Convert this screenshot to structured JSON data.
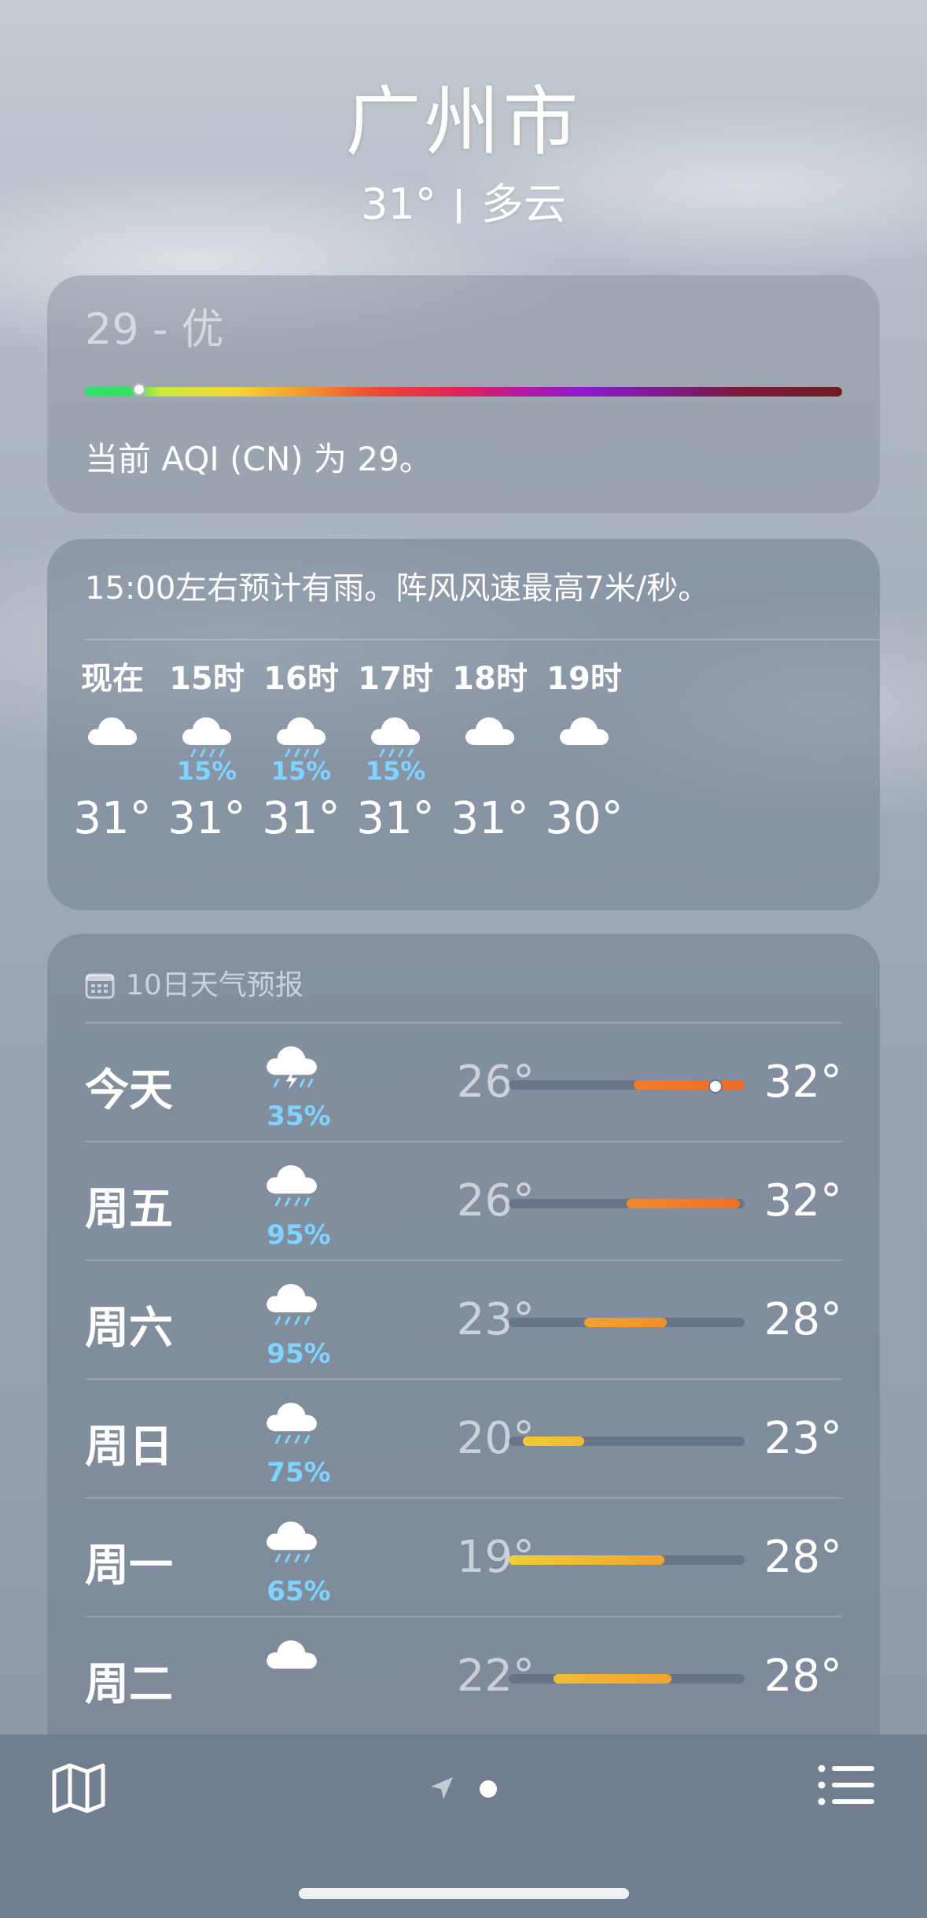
{
  "header": {
    "city": "广州市",
    "temp": "31°",
    "condition": "多云"
  },
  "aqi": {
    "value_label": "29 - 优",
    "description": "当前 AQI (CN) 为 29。",
    "value": 29
  },
  "hourly": {
    "description": "15:00左右预计有雨。阵风风速最高7米/秒。",
    "items": [
      {
        "label": "现在",
        "icon": "cloud-icon",
        "pop": "",
        "temp": "31°"
      },
      {
        "label": "15时",
        "icon": "cloud-rain-icon",
        "pop": "15%",
        "temp": "31°"
      },
      {
        "label": "16时",
        "icon": "cloud-rain-icon",
        "pop": "15%",
        "temp": "31°"
      },
      {
        "label": "17时",
        "icon": "cloud-rain-icon",
        "pop": "15%",
        "temp": "31°"
      },
      {
        "label": "18时",
        "icon": "cloud-icon",
        "pop": "",
        "temp": "31°"
      },
      {
        "label": "19时",
        "icon": "cloud-icon",
        "pop": "",
        "temp": "30°"
      }
    ]
  },
  "daily": {
    "title": "10日天气预报",
    "range_fraction": "bars positioned as fraction of overall weekly range",
    "days": [
      {
        "name": "今天",
        "icon": "cloud-bolt-rain-icon",
        "pop": "35%",
        "low": "26°",
        "high": "32°",
        "bar_start": 0.53,
        "bar_end": 1.0,
        "now_pos": 0.87,
        "color_from": "#f07d2a",
        "color_to": "#f06a26"
      },
      {
        "name": "周五",
        "icon": "cloud-rain-icon",
        "pop": "95%",
        "low": "26°",
        "high": "32°",
        "bar_start": 0.5,
        "bar_end": 0.98,
        "color_from": "#f08a2c",
        "color_to": "#ef6f27"
      },
      {
        "name": "周六",
        "icon": "cloud-rain-icon",
        "pop": "95%",
        "low": "23°",
        "high": "28°",
        "bar_start": 0.32,
        "bar_end": 0.67,
        "color_from": "#f2a22e",
        "color_to": "#f28e2b"
      },
      {
        "name": "周日",
        "icon": "cloud-rain-icon",
        "pop": "75%",
        "low": "20°",
        "high": "23°",
        "bar_start": 0.06,
        "bar_end": 0.32,
        "color_from": "#f0cd32",
        "color_to": "#f2b831"
      },
      {
        "name": "周一",
        "icon": "cloud-rain-icon",
        "pop": "65%",
        "low": "19°",
        "high": "28°",
        "bar_start": 0.0,
        "bar_end": 0.66,
        "color_from": "#eecf35",
        "color_to": "#f2a32d"
      },
      {
        "name": "周二",
        "icon": "cloud-icon",
        "pop": "",
        "low": "22°",
        "high": "28°",
        "bar_start": 0.19,
        "bar_end": 0.69,
        "color_from": "#f1bd32",
        "color_to": "#f2a22d"
      }
    ]
  },
  "toolbar": {
    "map": "map-icon",
    "location": "location-arrow-icon",
    "list": "list-icon"
  }
}
